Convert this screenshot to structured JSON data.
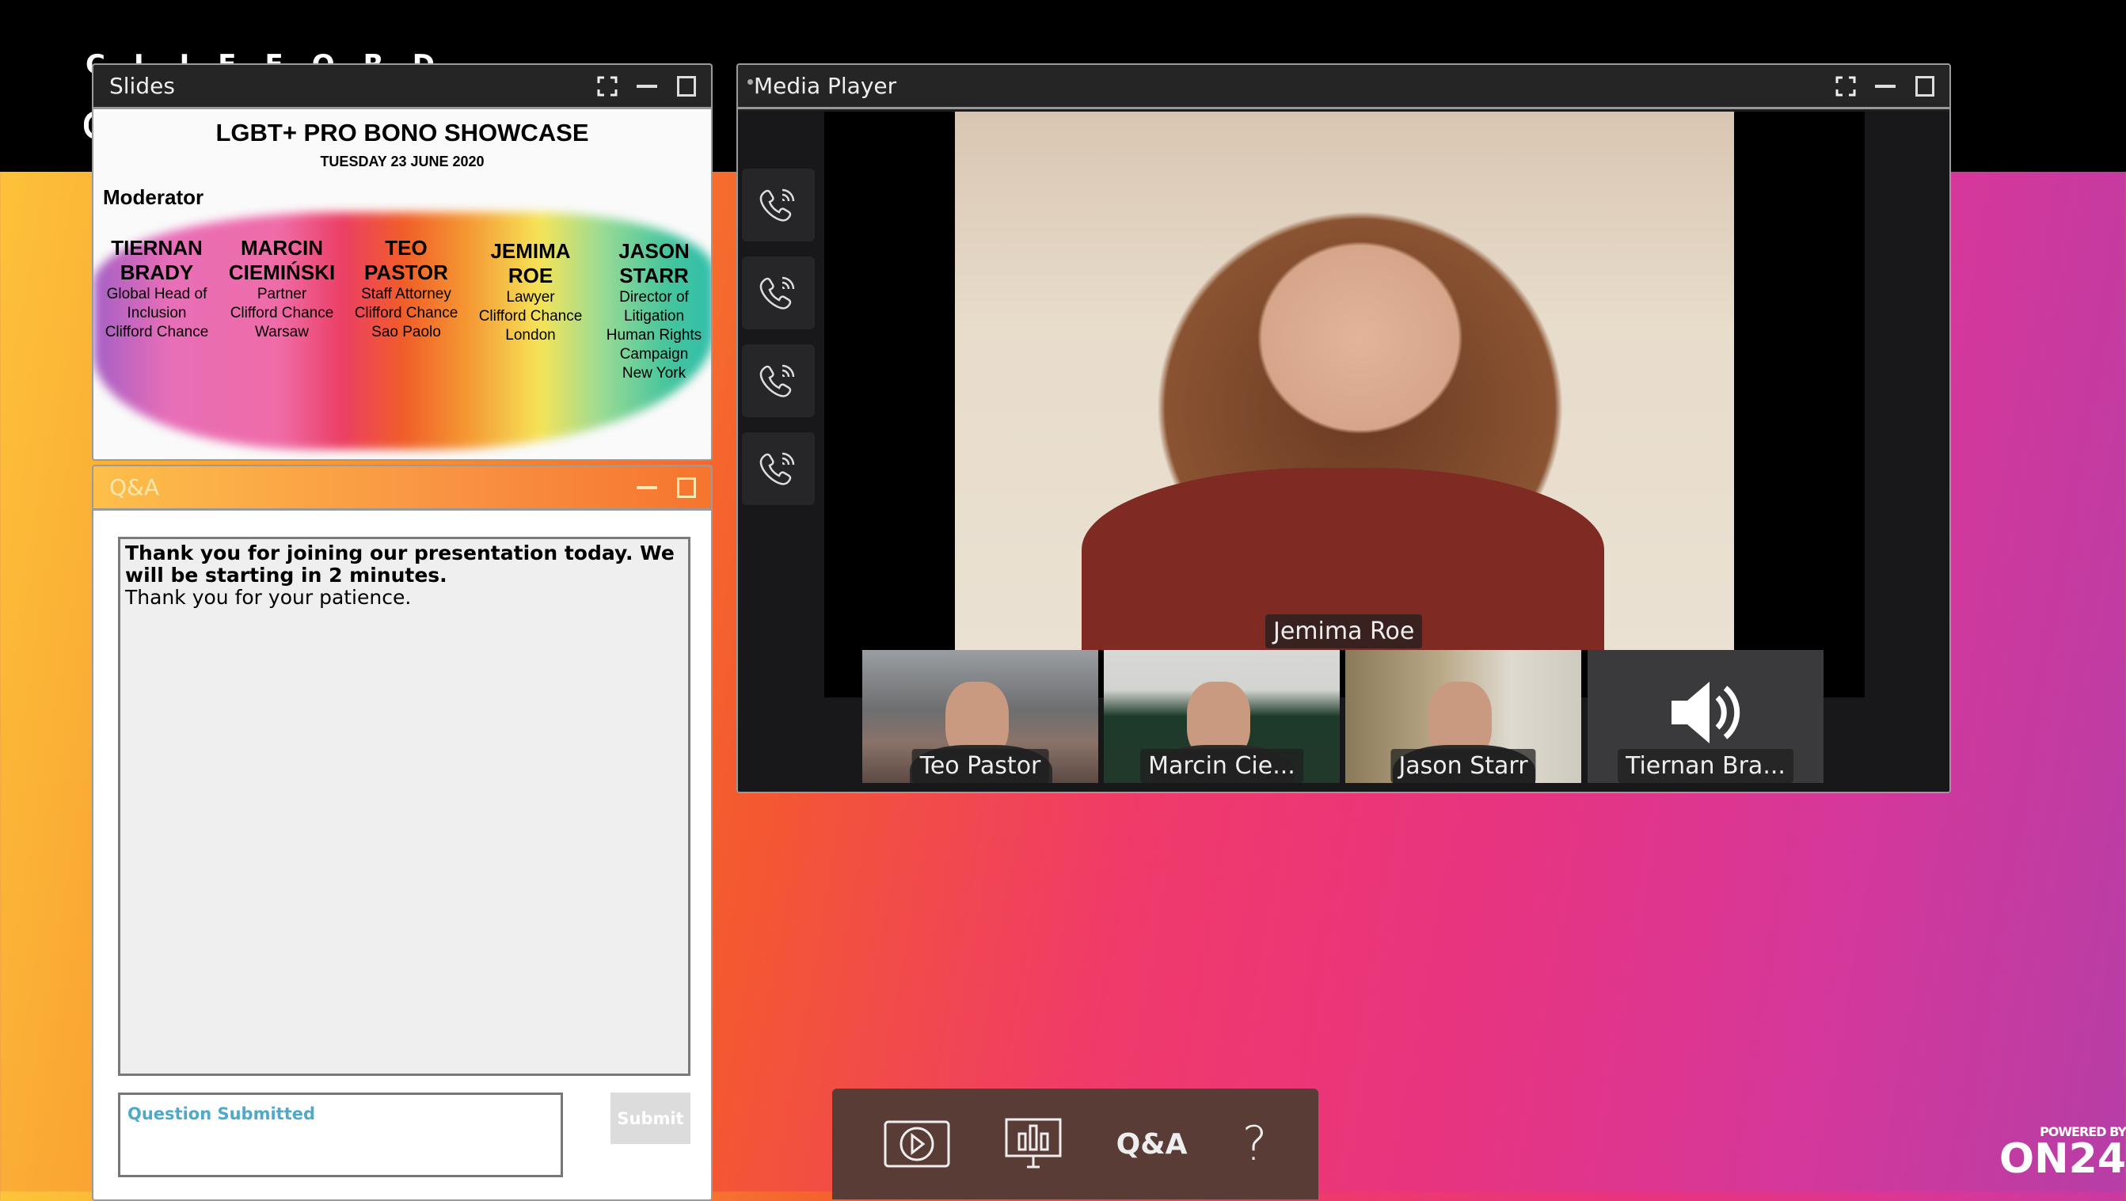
{
  "brand": {
    "logo_text": "CLIFFORD",
    "powered_by": "POWERED BY",
    "platform": "ON24"
  },
  "slides": {
    "title": "Slides",
    "content": {
      "heading": "LGBT+ PRO BONO SHOWCASE",
      "date": "TUESDAY 23 JUNE 2020",
      "moderator_label": "Moderator",
      "speakers": [
        {
          "name": "TIERNAN BRADY",
          "role": [
            "Global Head of",
            "Inclusion",
            "Clifford Chance"
          ]
        },
        {
          "name": "MARCIN CIEMIŃSKI",
          "role": [
            "Partner",
            "Clifford Chance",
            "Warsaw"
          ]
        },
        {
          "name": "TEO PASTOR",
          "role": [
            "Staff Attorney",
            "Clifford Chance",
            "Sao Paolo"
          ]
        },
        {
          "name": "JEMIMA ROE",
          "role": [
            "Lawyer",
            "Clifford Chance",
            "London"
          ]
        },
        {
          "name": "JASON STARR",
          "role": [
            "Director of",
            "Litigation",
            "Human Rights",
            "Campaign",
            "New York"
          ]
        }
      ]
    }
  },
  "qa": {
    "title": "Q&A",
    "message_bold": "Thank you for joining our presentation today. We will be starting in 2 minutes.",
    "message": "Thank you for your patience.",
    "input_value": "Question Submitted",
    "submit_label": "Submit"
  },
  "media": {
    "title": "Media Player",
    "active_speaker": "Jemima Roe",
    "participants": [
      {
        "name": "Teo Pastor"
      },
      {
        "name": "Marcin Cie..."
      },
      {
        "name": "Jason Starr"
      },
      {
        "name": "Tiernan Bra...",
        "audio_only": true
      }
    ],
    "call_buttons": 4
  },
  "toolbar": {
    "items": [
      {
        "icon": "media-player-icon"
      },
      {
        "icon": "slides-icon"
      },
      {
        "label": "Q&A"
      },
      {
        "label": "?"
      }
    ]
  }
}
